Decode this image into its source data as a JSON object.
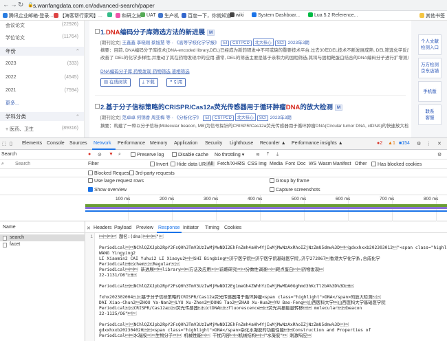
{
  "browser": {
    "url": "s.wanfangdata.com.cn/advanced-search/paper",
    "bookmarks": [
      {
        "label": "腾讯企业邮箱-登录...",
        "color": "#2a7de1"
      },
      {
        "label": "【海客帮行家网】...",
        "color": "#d44"
      },
      {
        "label": "",
        "color": "#3b8"
      },
      {
        "label": "和研之友",
        "color": "#e5a"
      },
      {
        "label": "UAT",
        "color": "#5a5"
      },
      {
        "label": "生产机",
        "color": "#47c"
      },
      {
        "label": "百度一下，你就知道",
        "color": "#36c"
      },
      {
        "label": "wiki",
        "color": "#444"
      },
      {
        "label": "System Dashboar...",
        "color": "#1a73e8"
      },
      {
        "label": "Lua 5.2 Reference...",
        "color": "#0b4"
      }
    ],
    "other_bookmarks": "其他书签"
  },
  "facets": {
    "rows_top": [
      {
        "label": "会议论文",
        "count": "(22926)"
      },
      {
        "label": "学位论文",
        "count": "(11764)"
      }
    ],
    "year_head": "年份",
    "years": [
      {
        "label": "2023",
        "count": "(333)"
      },
      {
        "label": "2022",
        "count": "(4545)"
      },
      {
        "label": "2021",
        "count": "(7594)"
      }
    ],
    "more": "更多...",
    "subject_head": "学科分类",
    "subject_row": {
      "label": "+ 医药、卫生",
      "count": "(89316)"
    }
  },
  "results": [
    {
      "index": "1.",
      "title_hl": "DNA",
      "title_rest": "编码分子库筛选方法的新进展",
      "badge": "M",
      "meta_prefix": "[期刊论文]",
      "meta_authors": "王鑫鑫  李晓刚  蔡旭慧 等",
      "meta_journal": "- 《高等学校化学学报》",
      "tags": [
        "EI",
        "CSTPCD",
        "北大核心",
        "SCI"
      ],
      "meta_issue": "2023年3期",
      "abstract": "摘要：目前, DNA编码分子库技术(DNA-encoded library,DEL)已经成为新药研发中不可或缺的重要技术平台.过去30年DEL技术不断发展成熟, DEL筛选化学反应在发展迅速",
      "abstract2": "改善了 DEL的化学多样性,并推动了其在药物发现中的应用.通常, DEL的筛选主要是基于亲和力的固相筛选,其将与固相靶蛋白结合的DNA编码分子进行扩增测序,方法的效率较高",
      "keywords": "DNA编码分子库   药物发现   药物筛选   液相筛选",
      "btn_read": "在线阅读",
      "btn_download": "下载",
      "btn_cite": "引用"
    },
    {
      "index": "2.",
      "title_pre": "基于分子信标策略的CRISPR/Cas12a荧光传感器用于循环肿瘤",
      "title_hl": "DNA",
      "title_rest": "的放大检测",
      "badge": "M",
      "meta_prefix": "[期刊论文]",
      "meta_authors": "范卓卓  何锦香  周亚梅 等",
      "meta_journal": "- 《分析化学》",
      "tags": [
        "EI",
        "CSTPCD",
        "北大核心",
        "SCI"
      ],
      "meta_issue": "2023年3期",
      "abstract": "摘要：构建了一种以分子信标(Molecular beacon, MB)为信号探针的CRISPR/Cas12a荧光传感器用于循环肿瘤DNA(Circular tumor DNA, ctDNA)的快速放大检测.MB具有良好"
    }
  ],
  "side_buttons": [
    {
      "l1": "个人文献",
      "l2": "检测入口"
    },
    {
      "l1": "万方检测",
      "l2": "京东店铺"
    },
    {
      "l1": "手机版",
      "l2": ""
    },
    {
      "l1": "联系",
      "l2": "客服"
    }
  ],
  "devtools": {
    "tabs": [
      "Elements",
      "Console",
      "Sources",
      "Network",
      "Performance",
      "Memory",
      "Application",
      "Security",
      "Lighthouse",
      "Recorder ▲",
      "Performance insights ▲"
    ],
    "active_tab": "Network",
    "badges": {
      "errors": "2",
      "warnings": "1",
      "issues": "154"
    },
    "search_label": "Search",
    "search_placeholder": "Search",
    "toolbar": {
      "preserve_log": "Preserve log",
      "disable_cache": "Disable cache",
      "throttling": "No throttling"
    },
    "filter": {
      "label": "Filter",
      "invert": "Invert",
      "hide_data_urls": "Hide data URLs",
      "types": [
        "All",
        "Fetch/XHR",
        "JS",
        "CSS",
        "Img",
        "Media",
        "Font",
        "Doc",
        "WS",
        "Wasm",
        "Manifest",
        "Other"
      ],
      "has_blocked_cookies": "Has blocked cookies",
      "blocked_requests": "Blocked Requests",
      "third_party": "3rd-party requests"
    },
    "options": {
      "large_rows": "Use large request rows",
      "group_by_frame": "Group by frame",
      "overview": "Show overview",
      "capture_screenshots": "Capture screenshots"
    },
    "timeline_ticks": [
      "100 ms",
      "200 ms",
      "300 ms",
      "400 ms",
      "500 ms",
      "600 ms",
      "700 ms",
      "800 ms",
      "900 ms"
    ],
    "name_header": "Name",
    "requests": [
      {
        "name": "search"
      },
      {
        "name": "facet"
      }
    ],
    "detail_tabs": [
      "Headers",
      "Payload",
      "Preview",
      "Response",
      "Initiator",
      "Timing",
      "Cookies"
    ],
    "active_detail_tab": "Response",
    "lines": [
      {
        "n": "1",
        "text": "\u0001\u0002\u0003\u0004 题名:(dna)\u0005\u0006\u0007\"\b"
      },
      {
        "n": "",
        "text": ""
      },
      {
        "n": "",
        "text": "Periodical\u000e\u000fNChlQZXJpb2RpY2FsQ0h3TmV3UzIwMjMwNDI2EhFnZmh4aHh4YjIwMjMwNzAxRhoIZjNzZmU5dmw%3D\u0010\u0011gdxxhxxb202303012\u0012\"<span class=\"highlight\">DNA</span>编码分子库筛选方法的新进展\u0013\u00142Ln-selection Selection Methods"
      },
      {
        "n": "",
        "text": "WANG Yingying2"
      },
      {
        "n": "",
        "text": "  LI Xiaomin2 CAI Yuhui2  LI Xiaoyu2\u0015\u0016SHI Bingbing\u0017济宁医学院\u0018济宁医学院基础医学院,济宁272067\u0019香港大学化学系,合成化学"
      },
      {
        "n": "",
        "text": "Periodical\u001a\u001bchem\u001c\u001dRegular\u001e\u001f"
      },
      {
        "n": "",
        "text": "Periodical\u0001\u0002\u0003   新进展\u0004\u0005library\u0006\u0007方法及应用\b\u000e前瞻研究\u000f\u0010分数性调查\u0011\u0012靶点蛋白\u0013\u0014药物发现\u0015"
      },
      {
        "n": "",
        "text": "22-1131/O6\"\u0016\u0017"
      },
      {
        "n": "",
        "text": ""
      },
      {
        "n": "",
        "text": "Periodical\u0018\u0019NChlQZXJpb2RpY2FsQ0h3TmV3UzIwMjMwNDI2Eg1meGh4ZWhhYzIwMjMwMDA0Gghmd3hKcTl2bA%3D%3D\u001a\u001b"
      },
      {
        "n": "",
        "text": ""
      },
      {
        "n": "",
        "text": "fxhx202302004\u001c\u001d基于分子信标策略的CRISPR/Cas12a荧光传感器用于循环肿瘤<span class=\"highlight\">DNA</span>的放大检测\u001e\u001f"
      },
      {
        "n": "",
        "text": "DAI Xiao-Chun2\u0001ZHOU Ya-Nan2\u0002LYU Xu-Zhen2\u0003DONG Tao2\u0004ZHAO Xu-Hua2\u0005YU Bao-Feng\u0006山西医科大学\u0007山西医科大学基础医学院"
      },
      {
        "n": "",
        "text": "Periodical\b\u000eCRISPR/Cas12a\u000f\u0010荧光传感器\u0011\u0012ctDNA\u0013\u0014fluorescence\u0015\u0016荧光共振能量转移\u0017\u0018  molecular\u0019\u001abeacon"
      },
      {
        "n": "",
        "text": "22-1125/O6\"\u001b\u001c"
      },
      {
        "n": "",
        "text": ""
      },
      {
        "n": "",
        "text": "Periodical\u001d\u001eNChlQZXJpb2RpY2FsQ0h3TmV3UzIwMjMwNDI2EhFnZmh4aHh4YjIwMjMwNzAxRhoIZjNzZmU5dmw%3D\u001f\u0001"
      },
      {
        "n": "",
        "text": "gdxxhxxb202304020\u0002\u0003<span class=\"highlight\">DNA</span>杂化水凝胶的功能性能\u0004\u0005Construction and Properties of"
      },
      {
        "n": "",
        "text": "Periodical\u0006\u0007水凝胶\b\u000e生物分子\u000f\u0010  机械性能\u0011\u0012 干扰内容\u0013\u0014机械结构\u0015\u0016\"水凝胶\"\u0017 刺激响应\u0018"
      }
    ]
  }
}
